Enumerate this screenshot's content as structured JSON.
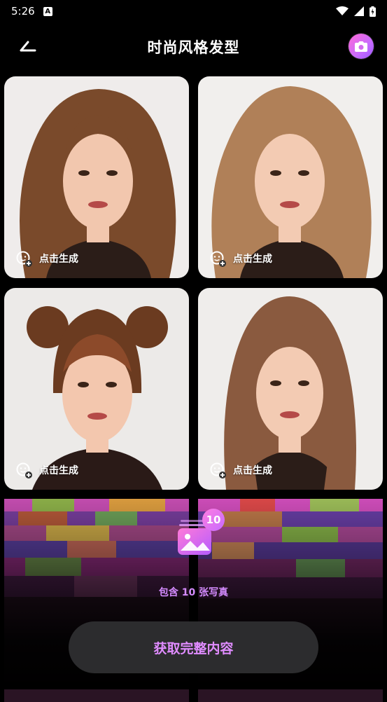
{
  "status_bar": {
    "time": "5:26",
    "app_badge": "A"
  },
  "header": {
    "title": "时尚风格发型",
    "back_icon": "back-arrow-icon",
    "camera_icon": "camera-icon"
  },
  "cards": [
    {
      "label": "点击生成",
      "hair_color": "#7a4a2b",
      "hair_style": "long curly"
    },
    {
      "label": "点击生成",
      "hair_color": "#b08058",
      "hair_style": "long wavy"
    },
    {
      "label": "点击生成",
      "hair_color": "#6b3b20",
      "hair_style": "space buns"
    },
    {
      "label": "点击生成",
      "hair_color": "#8a5a3f",
      "hair_style": "long straight"
    }
  ],
  "locked": {
    "count": "10",
    "contains_text": "包含 10 张写真",
    "cta_label": "获取完整内容"
  },
  "colors": {
    "accent": "#d58cff",
    "cta_bg": "#2c2c2e"
  }
}
